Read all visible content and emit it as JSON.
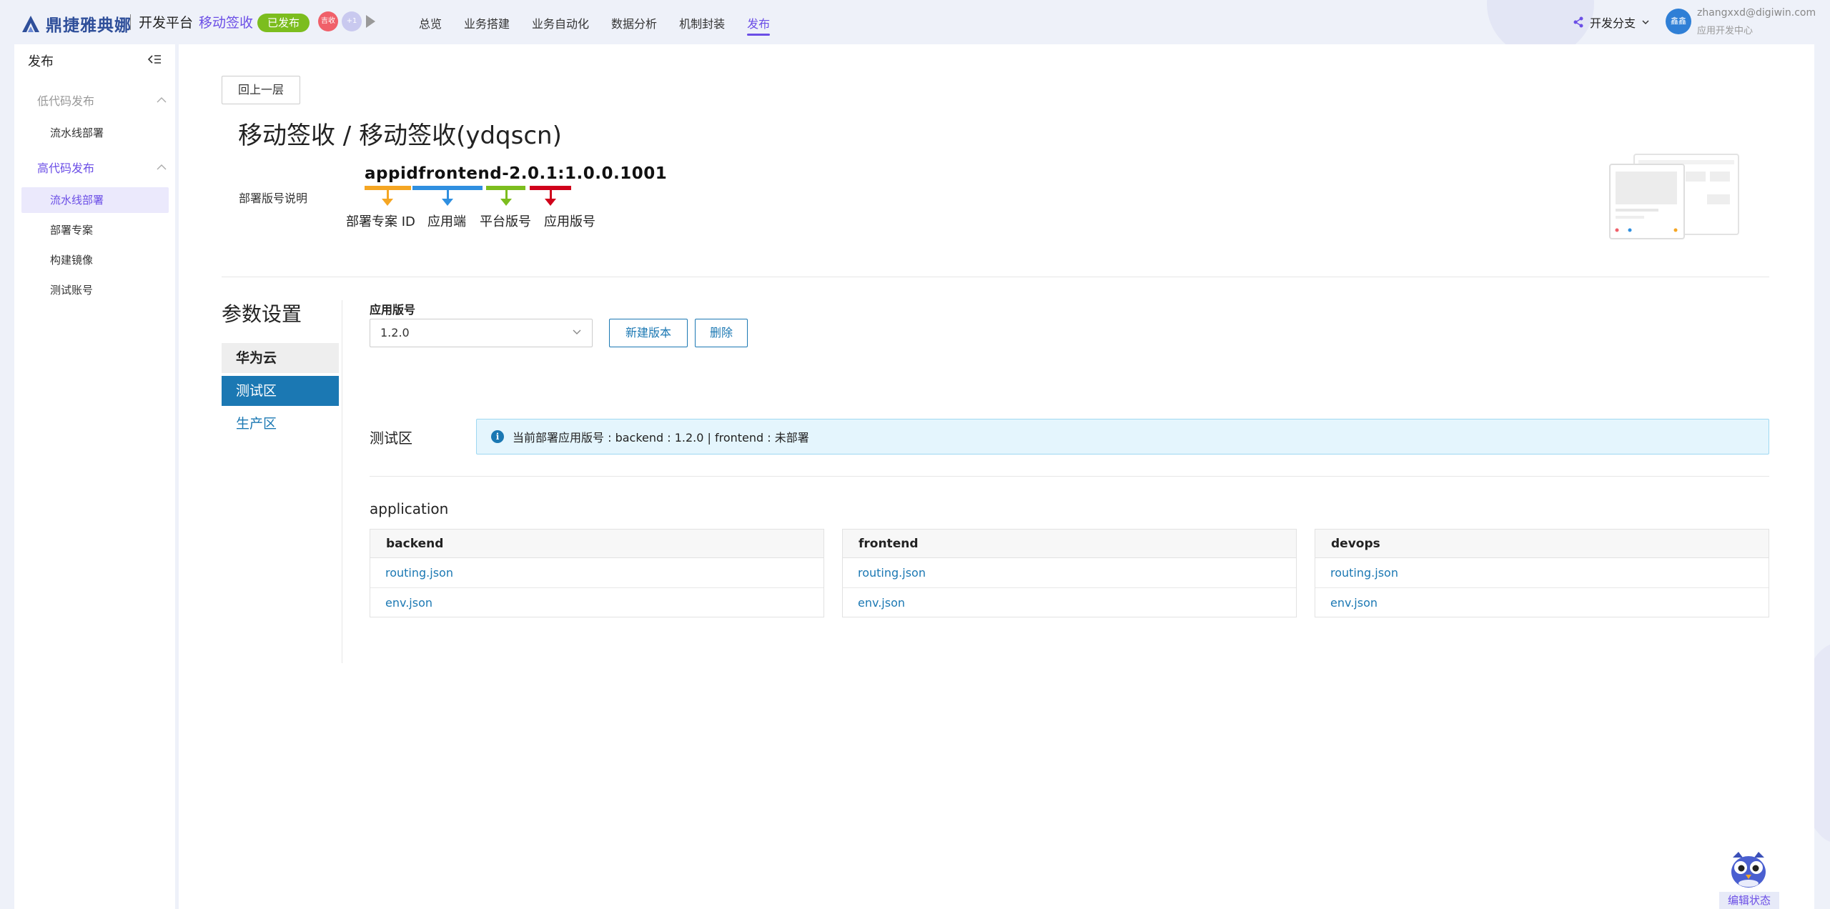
{
  "header": {
    "brand": "鼎捷雅典娜",
    "platform": "开发平台",
    "app_name": "移动签收",
    "status": "已发布",
    "collaborators": [
      "吉收",
      "+1"
    ],
    "nav": [
      "总览",
      "业务搭建",
      "业务自动化",
      "数据分析",
      "机制封装",
      "发布"
    ],
    "active_nav": "发布",
    "branch_label": "开发分支",
    "user_avatar": "鑫鑫",
    "user_email": "zhangxxd@digiwin.com",
    "user_role": "应用开发中心"
  },
  "sidebar": {
    "title": "发布",
    "groups": [
      {
        "label": "低代码发布",
        "items": [
          "流水线部署"
        ]
      },
      {
        "label": "高代码发布",
        "items": [
          "流水线部署",
          "部署专案",
          "构建镜像",
          "测试账号"
        ]
      }
    ],
    "active_item": "流水线部署"
  },
  "main": {
    "back_button": "回上一层",
    "title": "移动签收 / 移动签收(ydqscn)",
    "version_desc_label": "部署版号说明",
    "version_code": "appidfrontend-2.0.1:1.0.0.1001",
    "version_parts": [
      "部署专案 ID",
      "应用端",
      "平台版号",
      "应用版号"
    ],
    "params_title": "参数设置",
    "env_tabs": [
      "华为云",
      "测试区",
      "生产区"
    ],
    "selected_env": "测试区",
    "app_version_label": "应用版号",
    "app_version_value": "1.2.0",
    "new_version_button": "新建版本",
    "delete_button": "删除",
    "zone_label": "测试区",
    "info_text": "当前部署应用版号 : backend : 1.2.0 | frontend : 未部署",
    "application_label": "application",
    "cards": [
      {
        "name": "backend",
        "files": [
          "routing.json",
          "env.json"
        ]
      },
      {
        "name": "frontend",
        "files": [
          "routing.json",
          "env.json"
        ]
      },
      {
        "name": "devops",
        "files": [
          "routing.json",
          "env.json"
        ]
      }
    ]
  },
  "footer": {
    "edit_state": "编辑状态"
  },
  "colors": {
    "accent": "#6b4ee6",
    "primary": "#1b78b3",
    "published": "#7cbd1e",
    "seg_project_id": "#f5a623",
    "seg_app_end": "#2f8fe0",
    "seg_platform": "#7cbd1e",
    "seg_app_version": "#d0021b"
  }
}
